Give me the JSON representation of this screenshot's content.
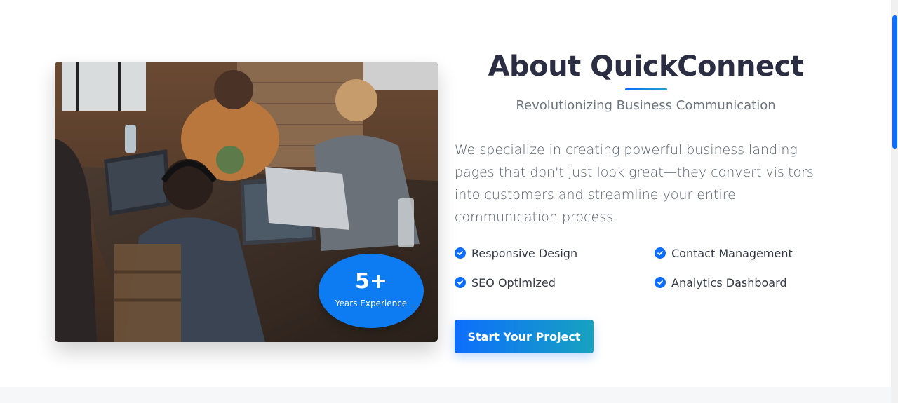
{
  "about": {
    "title": "About QuickConnect",
    "subtitle": "Revolutionizing Business Communication",
    "description": "We specialize in creating powerful business landing pages that don't just look great—they convert visitors into customers and streamline your entire communication process.",
    "features": [
      {
        "label": "Responsive Design",
        "icon": "check-circle-icon"
      },
      {
        "label": "Contact Management",
        "icon": "check-circle-icon"
      },
      {
        "label": "SEO Optimized",
        "icon": "check-circle-icon"
      },
      {
        "label": "Analytics Dashboard",
        "icon": "check-circle-icon"
      }
    ],
    "cta_label": "Start Your Project",
    "badge": {
      "number": "5+",
      "label": "Years Experience"
    }
  },
  "colors": {
    "accent": "#0d6efd",
    "accent_gradient_end": "#17a2c0",
    "title": "#2b2d42",
    "muted_text": "#6c757d",
    "section_alt_bg": "#f6f7f9"
  }
}
